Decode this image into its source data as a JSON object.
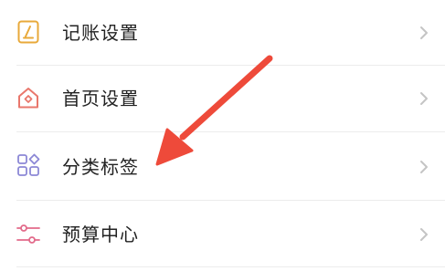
{
  "menu": {
    "items": [
      {
        "label": "记账设置",
        "icon": "notebook-pen-icon",
        "icon_color": "#E8A93A"
      },
      {
        "label": "首页设置",
        "icon": "home-icon",
        "icon_color": "#E9776C"
      },
      {
        "label": "分类标签",
        "icon": "category-grid-icon",
        "icon_color": "#8C88D6"
      },
      {
        "label": "预算中心",
        "icon": "sliders-icon",
        "icon_color": "#E26A8A"
      }
    ],
    "chevron_icon": "chevron-right-icon",
    "chevron_color": "#c4c4c4"
  },
  "annotation": {
    "icon": "red-arrow-icon",
    "color": "#EE4A3A"
  }
}
